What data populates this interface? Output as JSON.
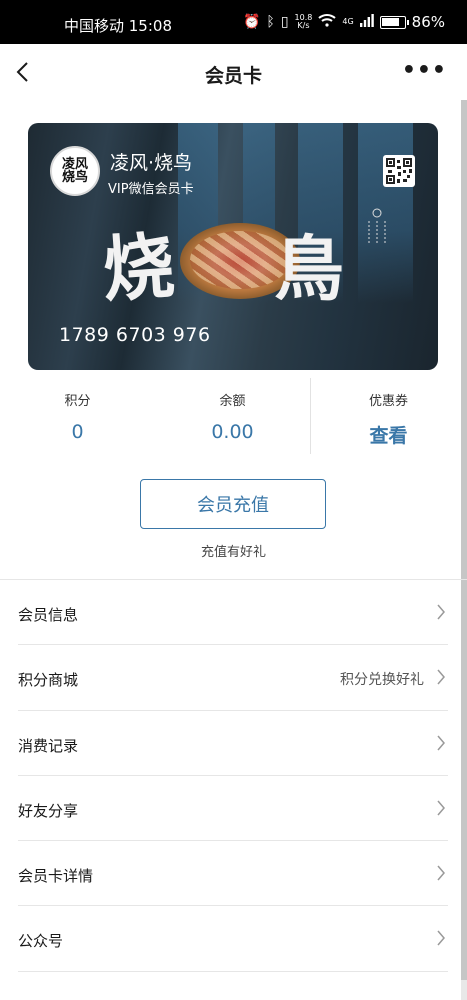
{
  "status_bar": {
    "carrier_time": "中国移动 15:08",
    "net_speed_value": "10.8",
    "net_speed_unit": "K/s",
    "network": "4G",
    "battery": "86%",
    "battery_level": 0.86
  },
  "nav": {
    "title": "会员卡",
    "more_label": "•••"
  },
  "card": {
    "logo_text_line1": "凌风",
    "logo_text_line2": "烧鸟",
    "brand": "凌风·烧鸟",
    "subtitle": "VIP微信会员卡",
    "art_char_1": "烧",
    "art_char_2": "鳥",
    "number": "1789 6703 976"
  },
  "stats": [
    {
      "label": "积分",
      "value": "0"
    },
    {
      "label": "余额",
      "value": "0.00"
    },
    {
      "label": "优惠券",
      "value": "查看"
    }
  ],
  "recharge": {
    "button_label": "会员充值",
    "tip": "充值有好礼"
  },
  "menu": [
    {
      "label": "会员信息",
      "hint": ""
    },
    {
      "label": "积分商城",
      "hint": "积分兑换好礼"
    },
    {
      "label": "消费记录",
      "hint": ""
    },
    {
      "label": "好友分享",
      "hint": ""
    },
    {
      "label": "会员卡详情",
      "hint": ""
    },
    {
      "label": "公众号",
      "hint": ""
    }
  ],
  "colors": {
    "accent": "#3a77a8",
    "status_bar_bg": "#000000",
    "divider": "#e6e6e6"
  }
}
